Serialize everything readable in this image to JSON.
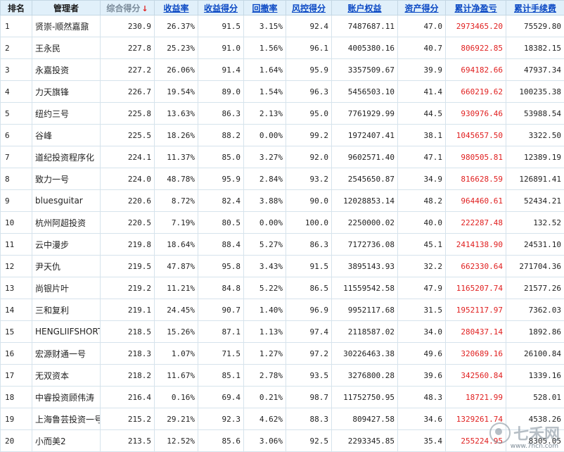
{
  "headers": [
    "排名",
    "管理者",
    "综合得分",
    "收益率",
    "收益得分",
    "回撤率",
    "风控得分",
    "账户权益",
    "资产得分",
    "累计净盈亏",
    "累计手续费"
  ],
  "sort_arrow": "↓",
  "rows": [
    [
      "1",
      "贤崇-顺然嘉鼐",
      "230.9",
      "26.37%",
      "91.5",
      "3.15%",
      "92.4",
      "7487687.11",
      "47.0",
      "2973465.20",
      "75529.80"
    ],
    [
      "2",
      "王永民",
      "227.8",
      "25.23%",
      "91.0",
      "1.56%",
      "96.1",
      "4005380.16",
      "40.7",
      "806922.85",
      "18382.15"
    ],
    [
      "3",
      "永嘉投资",
      "227.2",
      "26.06%",
      "91.4",
      "1.64%",
      "95.9",
      "3357509.67",
      "39.9",
      "694182.66",
      "47937.34"
    ],
    [
      "4",
      "力天旗锋",
      "226.7",
      "19.54%",
      "89.0",
      "1.54%",
      "96.3",
      "5456503.10",
      "41.4",
      "660219.62",
      "100235.38"
    ],
    [
      "5",
      "纽约三号",
      "225.8",
      "13.63%",
      "86.3",
      "2.13%",
      "95.0",
      "7761929.99",
      "44.5",
      "930976.46",
      "53988.54"
    ],
    [
      "6",
      "谷峰",
      "225.5",
      "18.26%",
      "88.2",
      "0.00%",
      "99.2",
      "1972407.41",
      "38.1",
      "1045657.50",
      "3322.50"
    ],
    [
      "7",
      "道纪投资程序化",
      "224.1",
      "11.37%",
      "85.0",
      "3.27%",
      "92.0",
      "9602571.40",
      "47.1",
      "980505.81",
      "12389.19"
    ],
    [
      "8",
      "致力一号",
      "224.0",
      "48.78%",
      "95.9",
      "2.84%",
      "93.2",
      "2545650.87",
      "34.9",
      "816628.59",
      "126891.41"
    ],
    [
      "9",
      "bluesguitar",
      "220.6",
      "8.72%",
      "82.4",
      "3.88%",
      "90.0",
      "12028853.14",
      "48.2",
      "964460.61",
      "52434.21"
    ],
    [
      "10",
      "杭州阿超投资",
      "220.5",
      "7.19%",
      "80.5",
      "0.00%",
      "100.0",
      "2250000.02",
      "40.0",
      "222287.48",
      "132.52"
    ],
    [
      "11",
      "云中漫步",
      "219.8",
      "18.64%",
      "88.4",
      "5.27%",
      "86.3",
      "7172736.08",
      "45.1",
      "2414138.90",
      "24531.10"
    ],
    [
      "12",
      "尹天仇",
      "219.5",
      "47.87%",
      "95.8",
      "3.43%",
      "91.5",
      "3895143.93",
      "32.2",
      "662330.64",
      "271704.36"
    ],
    [
      "13",
      "尚银片叶",
      "219.2",
      "11.21%",
      "84.8",
      "5.22%",
      "86.5",
      "11559542.58",
      "47.9",
      "1165207.74",
      "21577.26"
    ],
    [
      "14",
      "三和复利",
      "219.1",
      "24.45%",
      "90.7",
      "1.40%",
      "96.9",
      "9952117.68",
      "31.5",
      "1952117.97",
      "7362.03"
    ],
    [
      "15",
      "HENGLIIFSHORT",
      "218.5",
      "15.26%",
      "87.1",
      "1.13%",
      "97.4",
      "2118587.02",
      "34.0",
      "280437.14",
      "1892.86"
    ],
    [
      "16",
      "宏源财通一号",
      "218.3",
      "1.07%",
      "71.5",
      "1.27%",
      "97.2",
      "30226463.38",
      "49.6",
      "320689.16",
      "26100.84"
    ],
    [
      "17",
      "无双资本",
      "218.2",
      "11.67%",
      "85.1",
      "2.78%",
      "93.5",
      "3276800.28",
      "39.6",
      "342560.84",
      "1339.16"
    ],
    [
      "18",
      "中睿投资顾伟涛",
      "216.4",
      "0.16%",
      "69.4",
      "0.21%",
      "98.7",
      "11752750.95",
      "48.3",
      "18721.99",
      "528.01"
    ],
    [
      "19",
      "上海鲁芸投资一号",
      "215.2",
      "29.21%",
      "92.3",
      "4.62%",
      "88.3",
      "809427.58",
      "34.6",
      "1329261.74",
      "4538.26"
    ],
    [
      "20",
      "小而美2",
      "213.5",
      "12.52%",
      "85.6",
      "3.06%",
      "92.5",
      "2293345.85",
      "35.4",
      "255224.95",
      "8305.05"
    ]
  ],
  "watermark": {
    "text": "七禾网",
    "url": "www.7hcn.com"
  },
  "colors": {
    "header_bg": "#e1f0fa",
    "link": "#0a48c4",
    "profit": "#e02020",
    "grid": "#d6e3ec"
  }
}
